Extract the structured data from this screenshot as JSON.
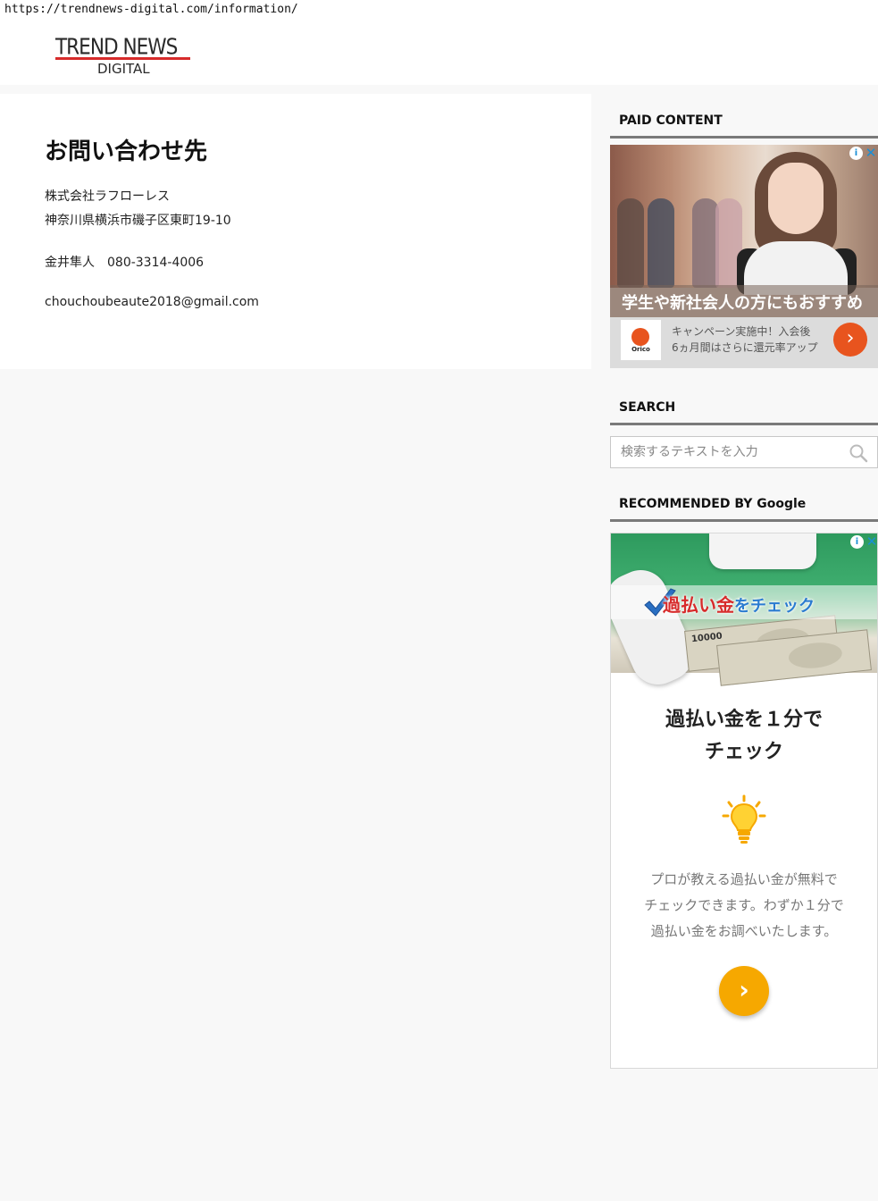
{
  "browser": {
    "url": "https://trendnews-digital.com/information/"
  },
  "header": {
    "logo_main": "TREND NEWS",
    "logo_sub": "DIGITAL"
  },
  "main": {
    "title": "お問い合わせ先",
    "company": "株式会社ラフローレス",
    "address": "神奈川県横浜市磯子区東町19-10",
    "contact": "金井隼人　080-3314-4006",
    "email": "chouchoubeaute2018@gmail.com"
  },
  "sidebar": {
    "paid_title": "PAID CONTENT",
    "ad1": {
      "headline": "学生や新社会人の方にもおすすめ",
      "brand": "Orico",
      "copy_line1": "キャンペーン実施中！入会後",
      "copy_line2": "6ヵ月間はさらに還元率アップ",
      "arrow": "›",
      "info": "i",
      "close": "✕"
    },
    "search_title": "SEARCH",
    "search_placeholder": "検索するテキストを入力",
    "recommended_title": "RECOMMENDED BY Google",
    "ad2": {
      "banner_main": "過払い金",
      "banner_small": "をチェック",
      "bill_number": "10000",
      "title_line1": "過払い金を１分で",
      "title_line2": "チェック",
      "desc_line1": "プロが教える過払い金が無料で",
      "desc_line2": "チェックできます。わずか１分で",
      "desc_line3": "過払い金をお調べいたします。",
      "arrow": "›",
      "info": "i",
      "close": "✕"
    }
  },
  "colors": {
    "accent_red": "#d72b2b",
    "orico_orange": "#e8541e",
    "ad2_cta": "#f6a800"
  }
}
